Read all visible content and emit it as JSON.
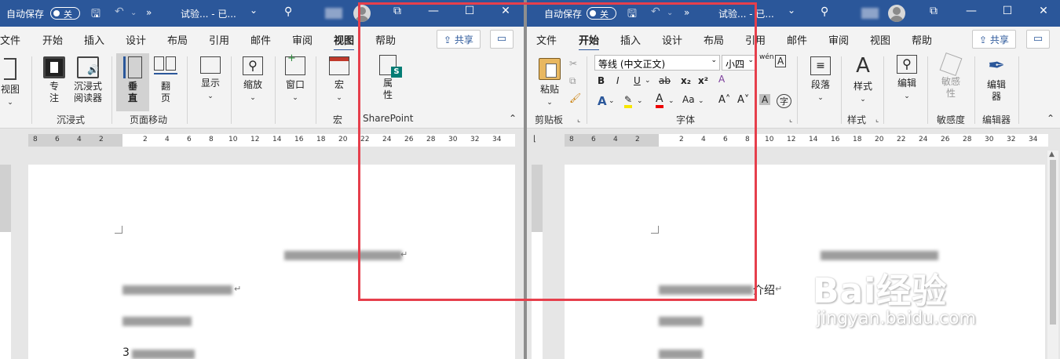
{
  "left_window": {
    "titlebar": {
      "autosave_label": "自动保存",
      "autosave_state": "关",
      "expand": "»",
      "doc_title": "试验... - 已...",
      "dropdown": "⌄"
    },
    "tabs": [
      "文件",
      "开始",
      "插入",
      "设计",
      "布局",
      "引用",
      "邮件",
      "审阅",
      "视图",
      "帮助"
    ],
    "active_tab": "视图",
    "share_label": "共享",
    "ribbon": {
      "view_label": "视图",
      "focus_label": "专注",
      "immersive_reader_label": "沉浸式阅读器",
      "vertical_label": "垂直",
      "side_label": "翻页",
      "show_label": "显示",
      "zoom_label": "缩放",
      "window_label": "窗口",
      "macro_label": "宏",
      "properties_label": "属性",
      "groups": {
        "immersive": "沉浸式",
        "page_move": "页面移动",
        "macro": "宏",
        "sharepoint": "SharePoint"
      }
    },
    "ruler_numbers": [
      "8",
      "6",
      "4",
      "2",
      "2",
      "4",
      "6",
      "8",
      "10",
      "12",
      "14",
      "16",
      "18",
      "20",
      "22",
      "24",
      "26",
      "28",
      "30",
      "32",
      "34"
    ],
    "doc": {
      "line_start": "3"
    }
  },
  "right_window": {
    "titlebar": {
      "autosave_label": "自动保存",
      "autosave_state": "关",
      "expand": "»",
      "doc_title": "试验... - 已...",
      "dropdown": "⌄"
    },
    "tabs": [
      "文件",
      "开始",
      "插入",
      "设计",
      "布局",
      "引用",
      "邮件",
      "审阅",
      "视图",
      "帮助"
    ],
    "active_tab": "开始",
    "share_label": "共享",
    "ribbon": {
      "paste_label": "粘贴",
      "font_name": "等线 (中文正文)",
      "font_size": "小四",
      "wen_label": "wén",
      "paragraph_label": "段落",
      "styles_label": "样式",
      "editing_label": "编辑",
      "sensitivity_label": "敏感性",
      "editor_label": "编辑器",
      "groups": {
        "clipboard": "剪贴板",
        "font": "字体",
        "styles": "样式",
        "sensitivity": "敏感度",
        "editor": "编辑器"
      }
    },
    "ruler_numbers": [
      "8",
      "6",
      "4",
      "2",
      "2",
      "4",
      "6",
      "8",
      "10",
      "12",
      "14",
      "16",
      "18",
      "20",
      "22",
      "24",
      "26",
      "28",
      "30",
      "32",
      "34"
    ],
    "doc": {
      "intro_suffix": "介绍"
    }
  },
  "watermark": {
    "brand": "Bai经验",
    "url": "jingyan.baidu.com"
  },
  "colors": {
    "titlebar": "#2b579a",
    "highlight_box": "#e63f4c"
  }
}
